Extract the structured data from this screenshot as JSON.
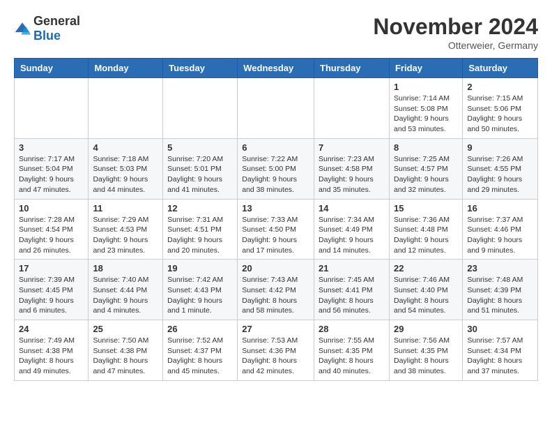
{
  "logo": {
    "general": "General",
    "blue": "Blue"
  },
  "header": {
    "month": "November 2024",
    "location": "Otterweier, Germany"
  },
  "weekdays": [
    "Sunday",
    "Monday",
    "Tuesday",
    "Wednesday",
    "Thursday",
    "Friday",
    "Saturday"
  ],
  "weeks": [
    [
      {
        "day": "",
        "info": ""
      },
      {
        "day": "",
        "info": ""
      },
      {
        "day": "",
        "info": ""
      },
      {
        "day": "",
        "info": ""
      },
      {
        "day": "",
        "info": ""
      },
      {
        "day": "1",
        "info": "Sunrise: 7:14 AM\nSunset: 5:08 PM\nDaylight: 9 hours and 53 minutes."
      },
      {
        "day": "2",
        "info": "Sunrise: 7:15 AM\nSunset: 5:06 PM\nDaylight: 9 hours and 50 minutes."
      }
    ],
    [
      {
        "day": "3",
        "info": "Sunrise: 7:17 AM\nSunset: 5:04 PM\nDaylight: 9 hours and 47 minutes."
      },
      {
        "day": "4",
        "info": "Sunrise: 7:18 AM\nSunset: 5:03 PM\nDaylight: 9 hours and 44 minutes."
      },
      {
        "day": "5",
        "info": "Sunrise: 7:20 AM\nSunset: 5:01 PM\nDaylight: 9 hours and 41 minutes."
      },
      {
        "day": "6",
        "info": "Sunrise: 7:22 AM\nSunset: 5:00 PM\nDaylight: 9 hours and 38 minutes."
      },
      {
        "day": "7",
        "info": "Sunrise: 7:23 AM\nSunset: 4:58 PM\nDaylight: 9 hours and 35 minutes."
      },
      {
        "day": "8",
        "info": "Sunrise: 7:25 AM\nSunset: 4:57 PM\nDaylight: 9 hours and 32 minutes."
      },
      {
        "day": "9",
        "info": "Sunrise: 7:26 AM\nSunset: 4:55 PM\nDaylight: 9 hours and 29 minutes."
      }
    ],
    [
      {
        "day": "10",
        "info": "Sunrise: 7:28 AM\nSunset: 4:54 PM\nDaylight: 9 hours and 26 minutes."
      },
      {
        "day": "11",
        "info": "Sunrise: 7:29 AM\nSunset: 4:53 PM\nDaylight: 9 hours and 23 minutes."
      },
      {
        "day": "12",
        "info": "Sunrise: 7:31 AM\nSunset: 4:51 PM\nDaylight: 9 hours and 20 minutes."
      },
      {
        "day": "13",
        "info": "Sunrise: 7:33 AM\nSunset: 4:50 PM\nDaylight: 9 hours and 17 minutes."
      },
      {
        "day": "14",
        "info": "Sunrise: 7:34 AM\nSunset: 4:49 PM\nDaylight: 9 hours and 14 minutes."
      },
      {
        "day": "15",
        "info": "Sunrise: 7:36 AM\nSunset: 4:48 PM\nDaylight: 9 hours and 12 minutes."
      },
      {
        "day": "16",
        "info": "Sunrise: 7:37 AM\nSunset: 4:46 PM\nDaylight: 9 hours and 9 minutes."
      }
    ],
    [
      {
        "day": "17",
        "info": "Sunrise: 7:39 AM\nSunset: 4:45 PM\nDaylight: 9 hours and 6 minutes."
      },
      {
        "day": "18",
        "info": "Sunrise: 7:40 AM\nSunset: 4:44 PM\nDaylight: 9 hours and 4 minutes."
      },
      {
        "day": "19",
        "info": "Sunrise: 7:42 AM\nSunset: 4:43 PM\nDaylight: 9 hours and 1 minute."
      },
      {
        "day": "20",
        "info": "Sunrise: 7:43 AM\nSunset: 4:42 PM\nDaylight: 8 hours and 58 minutes."
      },
      {
        "day": "21",
        "info": "Sunrise: 7:45 AM\nSunset: 4:41 PM\nDaylight: 8 hours and 56 minutes."
      },
      {
        "day": "22",
        "info": "Sunrise: 7:46 AM\nSunset: 4:40 PM\nDaylight: 8 hours and 54 minutes."
      },
      {
        "day": "23",
        "info": "Sunrise: 7:48 AM\nSunset: 4:39 PM\nDaylight: 8 hours and 51 minutes."
      }
    ],
    [
      {
        "day": "24",
        "info": "Sunrise: 7:49 AM\nSunset: 4:38 PM\nDaylight: 8 hours and 49 minutes."
      },
      {
        "day": "25",
        "info": "Sunrise: 7:50 AM\nSunset: 4:38 PM\nDaylight: 8 hours and 47 minutes."
      },
      {
        "day": "26",
        "info": "Sunrise: 7:52 AM\nSunset: 4:37 PM\nDaylight: 8 hours and 45 minutes."
      },
      {
        "day": "27",
        "info": "Sunrise: 7:53 AM\nSunset: 4:36 PM\nDaylight: 8 hours and 42 minutes."
      },
      {
        "day": "28",
        "info": "Sunrise: 7:55 AM\nSunset: 4:35 PM\nDaylight: 8 hours and 40 minutes."
      },
      {
        "day": "29",
        "info": "Sunrise: 7:56 AM\nSunset: 4:35 PM\nDaylight: 8 hours and 38 minutes."
      },
      {
        "day": "30",
        "info": "Sunrise: 7:57 AM\nSunset: 4:34 PM\nDaylight: 8 hours and 37 minutes."
      }
    ]
  ]
}
